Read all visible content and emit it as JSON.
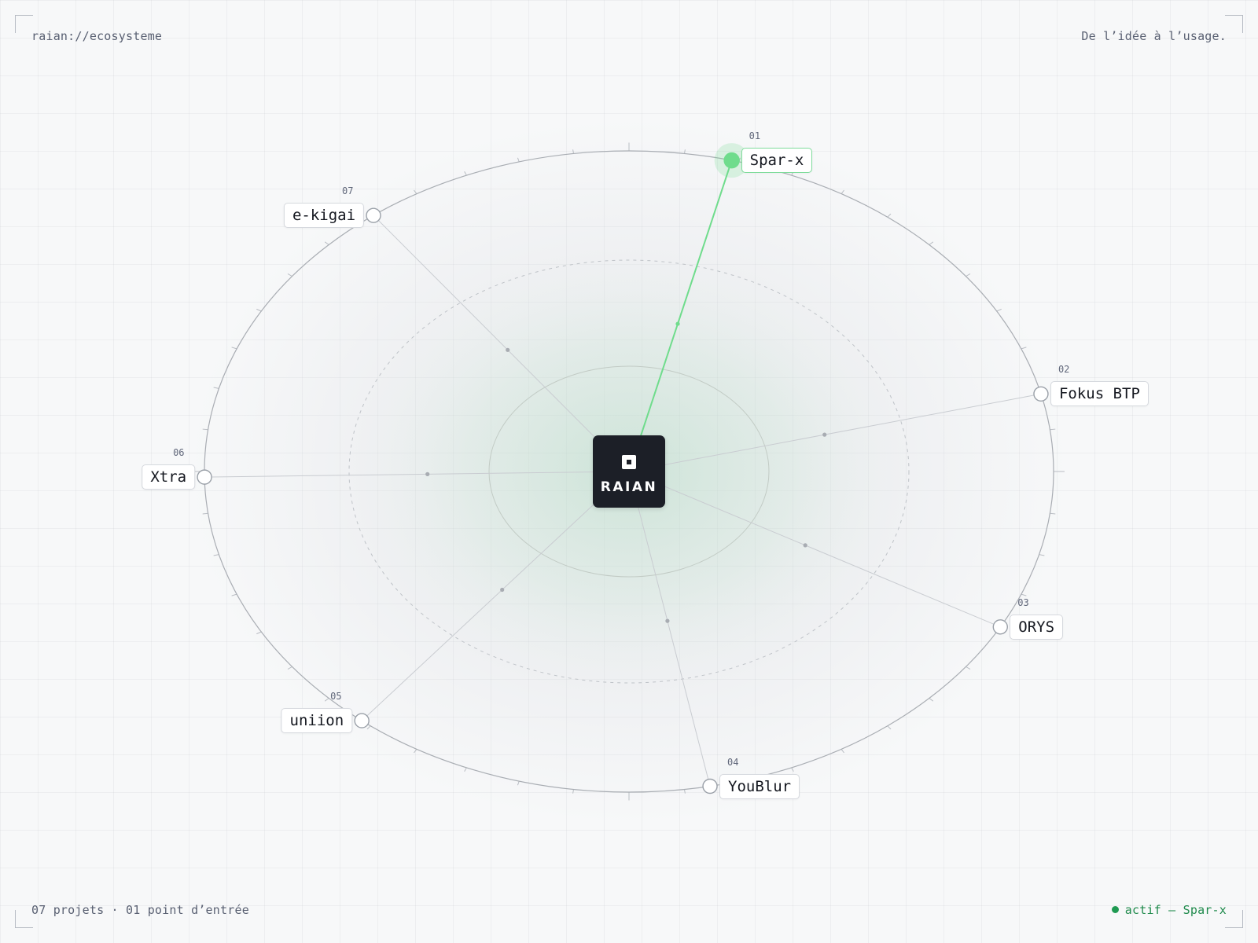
{
  "header": {
    "path": "raian://ecosysteme",
    "tagline": "De l’idée à l’usage."
  },
  "footer": {
    "summary": "07 projets · 01 point d’entrée",
    "active_status": "actif — Spar-x"
  },
  "hub": {
    "name": "RAIAN",
    "icon": "square-logo-icon"
  },
  "active_node": "Spar-x",
  "colors": {
    "accent": "#6fdc8c",
    "accent_text": "#1f8a4c",
    "hub": "#1c1f27",
    "line": "#c9ccd1"
  },
  "nodes": [
    {
      "num": "01",
      "name": "Spar-x",
      "active": true
    },
    {
      "num": "02",
      "name": "Fokus BTP",
      "active": false
    },
    {
      "num": "03",
      "name": "ORYS",
      "active": false
    },
    {
      "num": "04",
      "name": "YouBlur",
      "active": false
    },
    {
      "num": "05",
      "name": "uniion",
      "active": false
    },
    {
      "num": "06",
      "name": "Xtra",
      "active": false
    },
    {
      "num": "07",
      "name": "e-kigai",
      "active": false
    }
  ]
}
